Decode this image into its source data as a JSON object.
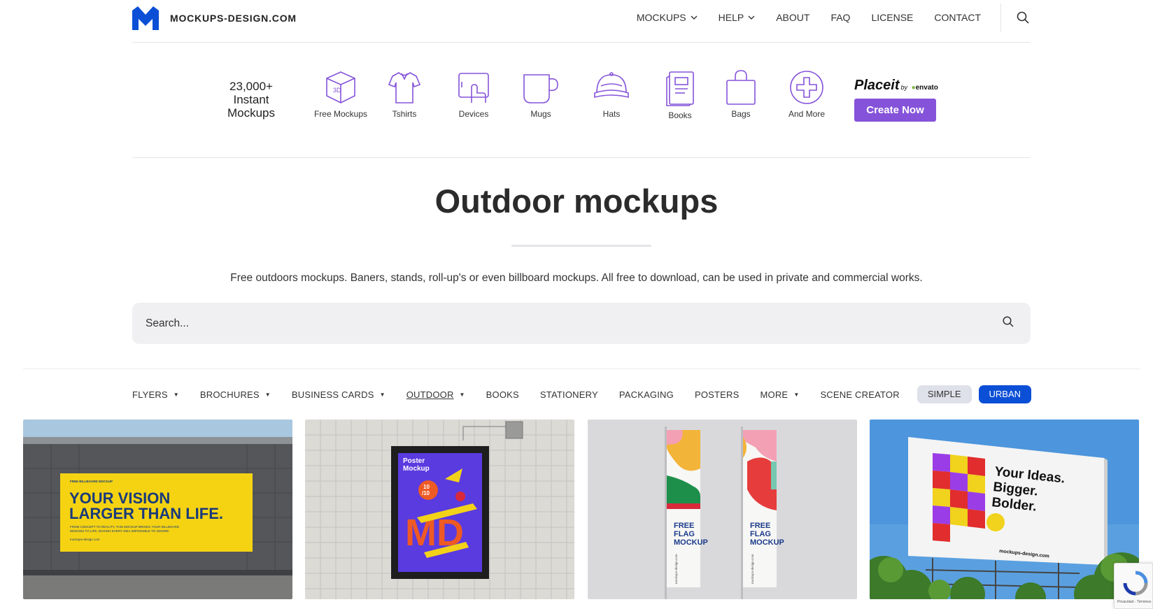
{
  "header": {
    "logo_text": "MOCKUPS-DESIGN.COM",
    "brand_color": "#0b4fd6",
    "nav": [
      {
        "label": "MOCKUPS",
        "dropdown": true
      },
      {
        "label": "HELP",
        "dropdown": true
      },
      {
        "label": "ABOUT",
        "dropdown": false
      },
      {
        "label": "FAQ",
        "dropdown": false
      },
      {
        "label": "LICENSE",
        "dropdown": false
      },
      {
        "label": "CONTACT",
        "dropdown": false
      }
    ]
  },
  "promo": {
    "count_line1": "23,000+",
    "count_line2": "Instant",
    "count_line3": "Mockups",
    "categories": [
      {
        "label": "Free Mockups",
        "icon": "3d-box-icon"
      },
      {
        "label": "Tshirts",
        "icon": "tshirt-icon"
      },
      {
        "label": "Devices",
        "icon": "tablet-hand-icon"
      },
      {
        "label": "Mugs",
        "icon": "mug-icon"
      },
      {
        "label": "Hats",
        "icon": "cap-icon"
      },
      {
        "label": "Books",
        "icon": "book-icon"
      },
      {
        "label": "Bags",
        "icon": "bag-icon"
      },
      {
        "label": "And More",
        "icon": "plus-circle-icon"
      }
    ],
    "icon_color": "#8553d9",
    "placeit_logo": "Placeit",
    "placeit_by": "by",
    "placeit_envato": "envato",
    "cta_label": "Create Now",
    "cta_color": "#8553d9"
  },
  "hero": {
    "title": "Outdoor mockups",
    "description": "Free outdoors mockups. Baners, stands, roll-up's or even billboard mockups. All free to download, can be used in private and commercial works."
  },
  "search": {
    "placeholder": "Search..."
  },
  "filters": [
    {
      "label": "FLYERS",
      "dropdown": true,
      "active": false
    },
    {
      "label": "BROCHURES",
      "dropdown": true,
      "active": false
    },
    {
      "label": "BUSINESS CARDS",
      "dropdown": true,
      "active": false
    },
    {
      "label": "OUTDOOR",
      "dropdown": true,
      "active": true
    },
    {
      "label": "BOOKS",
      "dropdown": false,
      "active": false
    },
    {
      "label": "STATIONERY",
      "dropdown": false,
      "active": false
    },
    {
      "label": "PACKAGING",
      "dropdown": false,
      "active": false
    },
    {
      "label": "POSTERS",
      "dropdown": false,
      "active": false
    },
    {
      "label": "MORE",
      "dropdown": true,
      "active": false
    },
    {
      "label": "SCENE CREATOR",
      "dropdown": false,
      "active": false
    }
  ],
  "pills": {
    "simple": "SIMPLE",
    "urban": "URBAN"
  },
  "cards": {
    "card1": {
      "small": "FREE BILLBOARD MOCKUP",
      "line1": "YOUR VISION",
      "line2": "LARGER THAN LIFE.",
      "sub1": "FROM CONCEPT TO REALITY, THIS MOCKUP BRINGS YOUR BILLBOARD",
      "sub2": "DESIGNS TO LIFE, MAKING EVERY IDEA IMPOSSIBLE TO IGNORE.",
      "url": "mockups-design.com"
    },
    "card2": {
      "title1": "Poster",
      "title2": "Mockup",
      "badge1": "10",
      "badge2": "/10",
      "big": "MD"
    },
    "card3": {
      "l1": "FREE",
      "l2": "FLAG",
      "l3": "MOCKUP",
      "vertical": "mockups-design.com"
    },
    "card4": {
      "l1": "Your Ideas.",
      "l2": "Bigger.",
      "l3": "Bolder.",
      "url": "mockups-design.com"
    }
  },
  "recaptcha": {
    "text": "Privacidad - Términos"
  }
}
